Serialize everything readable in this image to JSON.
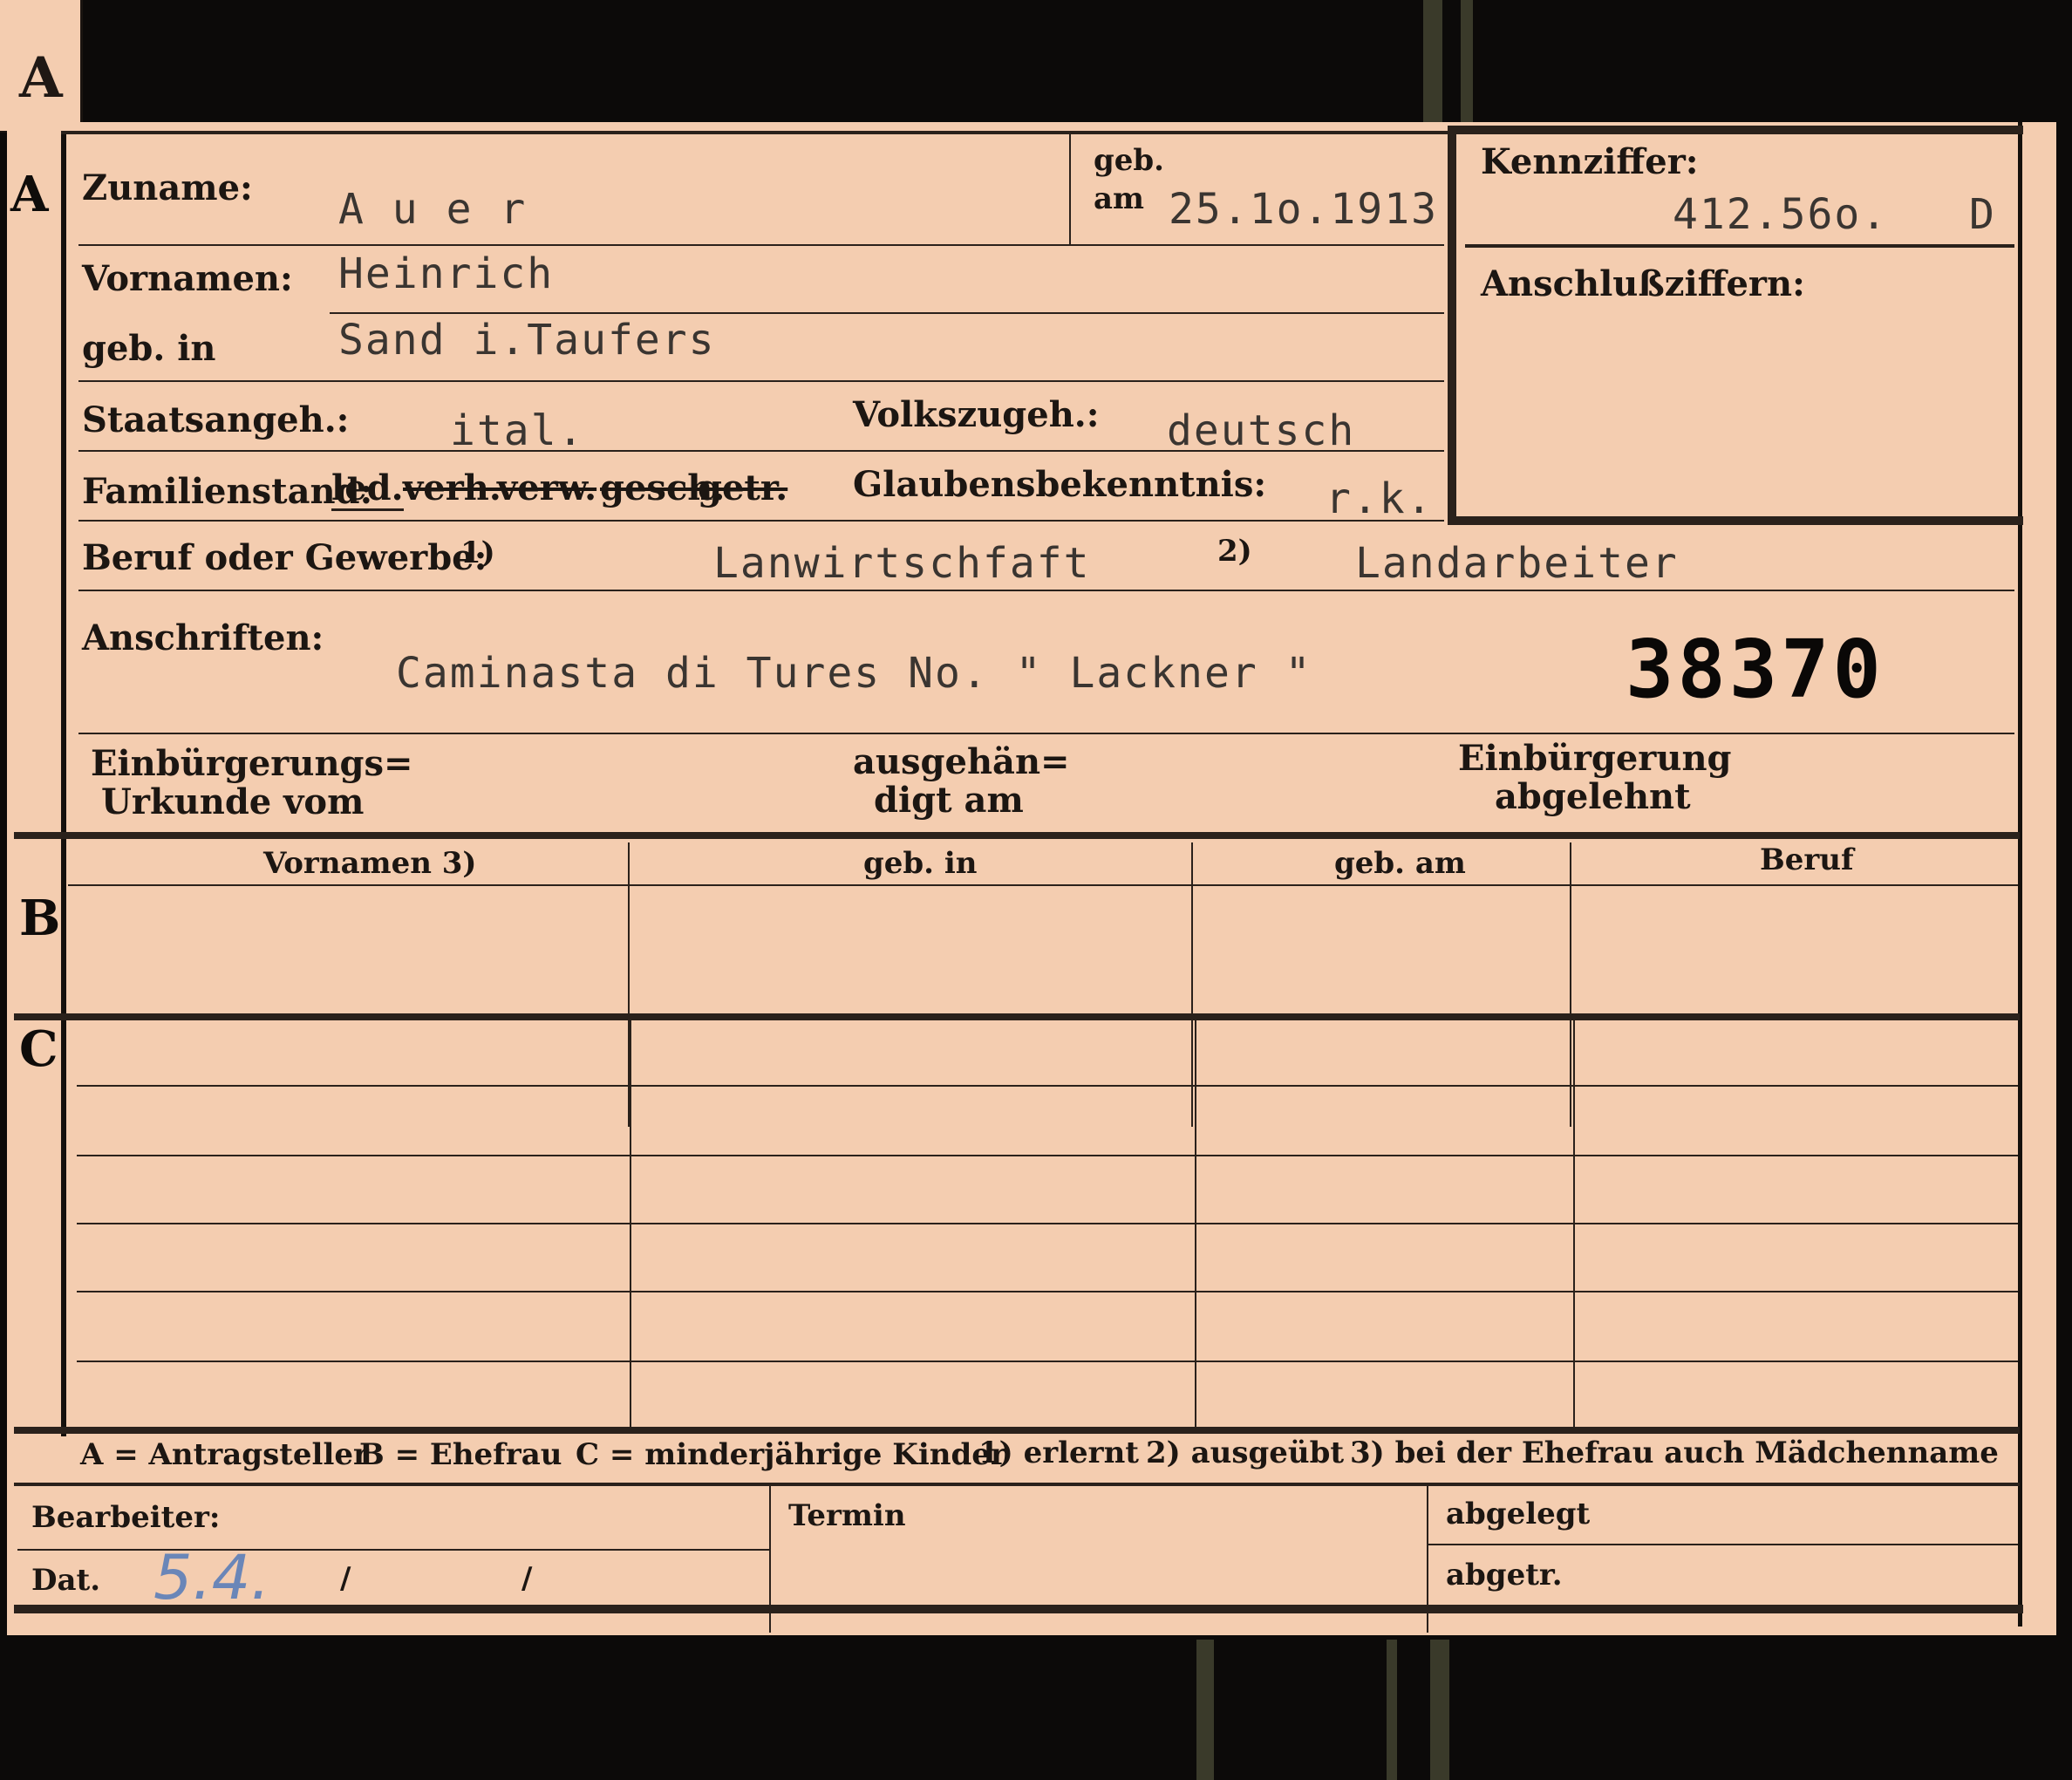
{
  "tab": {
    "letter": "A"
  },
  "sections": {
    "a": "A",
    "b": "B",
    "c": "C"
  },
  "labels": {
    "zuname": "Zuname:",
    "geb_am_top": "geb.",
    "geb_am_bottom": "am",
    "kennziffer": "Kennziffer:",
    "anschlussziffern": "Anschlußziffern:",
    "vornamen": "Vornamen:",
    "geb_in": "geb. in",
    "staatsangeh": "Staatsangeh.:",
    "volkszugeh": "Volkszugeh.:",
    "familienstand": "Familienstand:",
    "familienstand_options": [
      "led.",
      "verh.",
      "verw.",
      "gesch.",
      "getr."
    ],
    "glaubensbekenntnis": "Glaubensbekenntnis:",
    "beruf": "Beruf oder Gewerbe:",
    "beruf_note1": "1)",
    "beruf_note2": "2)",
    "anschriften": "Anschriften:",
    "einbuergerungsurkunde_1": "Einbürgerungs=",
    "einbuergerungsurkunde_2": "Urkunde vom",
    "ausgehaendigt_1": "ausgehän=",
    "ausgehaendigt_2": "digt am",
    "abgelehnt_1": "Einbürgerung",
    "abgelehnt_2": "abgelehnt"
  },
  "values": {
    "zuname": "A u e r",
    "geb_am": "25.1o.1913",
    "kennziffer": "412.56o.",
    "kennziffer_suffix": "D",
    "vornamen": "Heinrich",
    "geb_in": "Sand i.Taufers",
    "staatsangeh": "ital.",
    "volkszugeh": "deutsch",
    "glaubensbekenntnis": "r.k.",
    "beruf_erlernt": "Lanwirtschfaft",
    "beruf_ausgeuebt": "Landarbeiter",
    "anschrift": "Caminasta di Tures No. \" Lackner \"",
    "stamp_number": "38370"
  },
  "table_b": {
    "headers": [
      "Vornamen 3)",
      "geb. in",
      "geb. am",
      "Beruf"
    ]
  },
  "legend": {
    "a": "A = Antragsteller",
    "b": "B = Ehefrau",
    "c": "C = minderjährige Kinder",
    "n1": "1) erlernt",
    "n2": "2) ausgeübt",
    "n3": "3) bei der Ehefrau auch Mädchenname"
  },
  "footer": {
    "bearbeiter": "Bearbeiter:",
    "dat": "Dat.",
    "dat_hand": "5.4.",
    "dat_slash1": "/",
    "dat_slash2": "/",
    "termin": "Termin",
    "abgelegt": "abgelegt",
    "abgetr": "abgetr."
  }
}
